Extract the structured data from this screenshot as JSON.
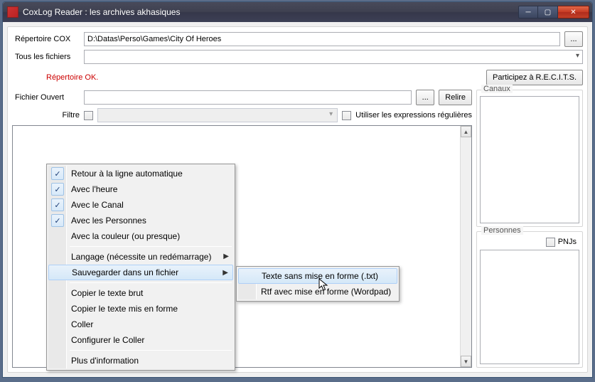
{
  "title": "CoxLog Reader : les archives akhasiques",
  "labels": {
    "repertoire": "Répertoire COX",
    "tous_fichiers": "Tous les fichiers",
    "fichier_ouvert": "Fichier Ouvert",
    "filtre": "Filtre",
    "regex": "Utiliser les expressions régulières",
    "canaux": "Canaux",
    "personnes": "Personnes",
    "pnjs": "PNJs"
  },
  "values": {
    "repertoire_path": "D:\\Datas\\Perso\\Games\\City Of Heroes",
    "fichier_ouvert": ""
  },
  "status": "Répertoire OK.",
  "buttons": {
    "browse": "...",
    "relire": "Relire",
    "participez": "Participez à R.E.C.I.T.S."
  },
  "context_menu": {
    "retour_ligne": "Retour à la ligne automatique",
    "avec_heure": "Avec l'heure",
    "avec_canal": "Avec le Canal",
    "avec_personnes": "Avec les Personnes",
    "avec_couleur": "Avec la couleur (ou presque)",
    "langage": "Langage (nécessite un redémarrage)",
    "sauvegarder": "Sauvegarder dans un fichier",
    "copier_brut": "Copier le texte brut",
    "copier_mis": "Copier le texte mis en forme",
    "coller": "Coller",
    "configurer": "Configurer le Coller",
    "plus_info": "Plus d'information"
  },
  "submenu": {
    "txt": "Texte sans mise en forme (.txt)",
    "rtf": "Rtf avec mise en forme (Wordpad)"
  }
}
